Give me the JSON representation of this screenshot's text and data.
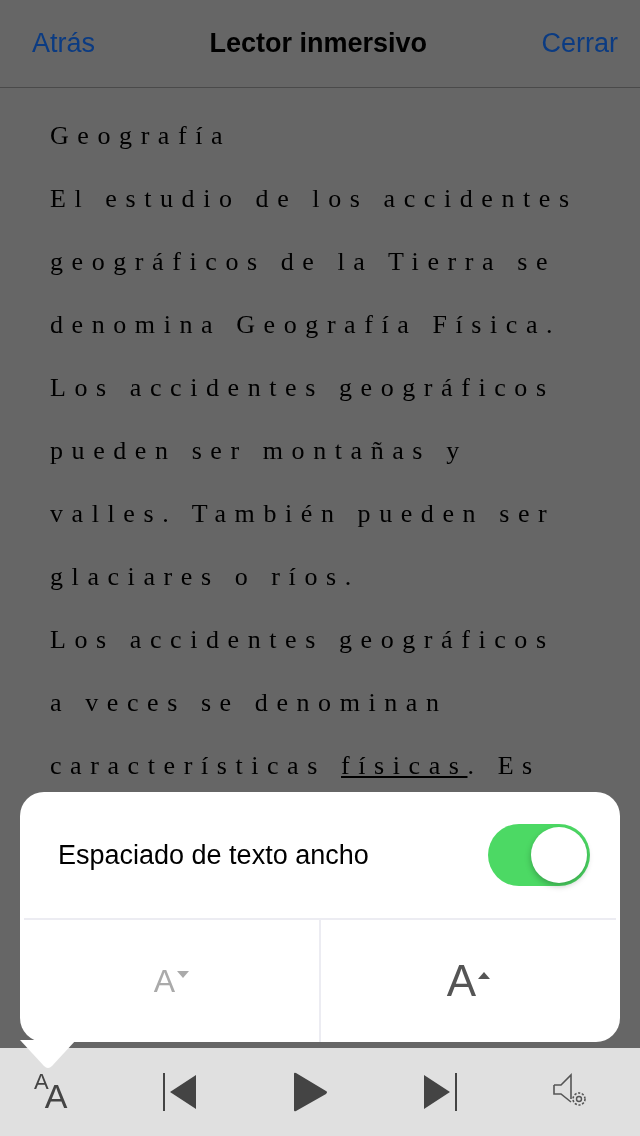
{
  "header": {
    "back": "Atrás",
    "title": "Lector inmersivo",
    "close": "Cerrar"
  },
  "reading_lines": [
    [
      {
        "text": "Geografía",
        "underlined": false
      }
    ],
    [
      {
        "text": "El estudio de los accidentes",
        "underlined": false
      }
    ],
    [
      {
        "text": "geográficos de la Tierra se",
        "underlined": false
      }
    ],
    [
      {
        "text": "denomina Geografía Física.",
        "underlined": false
      }
    ],
    [
      {
        "text": "Los accidentes geográficos",
        "underlined": false
      }
    ],
    [
      {
        "text": "pueden ser montañas y",
        "underlined": false
      }
    ],
    [
      {
        "text": "valles. También pueden ser",
        "underlined": false
      }
    ],
    [
      {
        "text": "glaciares o ríos.",
        "underlined": false
      }
    ],
    [
      {
        "text": "Los accidentes geográficos",
        "underlined": false
      }
    ],
    [
      {
        "text": "a veces se denominan",
        "underlined": false
      }
    ],
    [
      {
        "text": "características ",
        "underlined": false
      },
      {
        "text": "físicas",
        "underlined": true
      },
      {
        "text": ". Es",
        "underlined": false
      }
    ]
  ],
  "popup": {
    "toggle": {
      "label": "Espaciado de texto ancho",
      "on": true
    },
    "buttons": [
      {
        "kind": "decrease",
        "label": "A",
        "disabled": true
      },
      {
        "kind": "increase",
        "label": "A",
        "disabled": false
      }
    ]
  },
  "toolbar": {
    "text_size_letters": [
      "A",
      "A"
    ]
  }
}
